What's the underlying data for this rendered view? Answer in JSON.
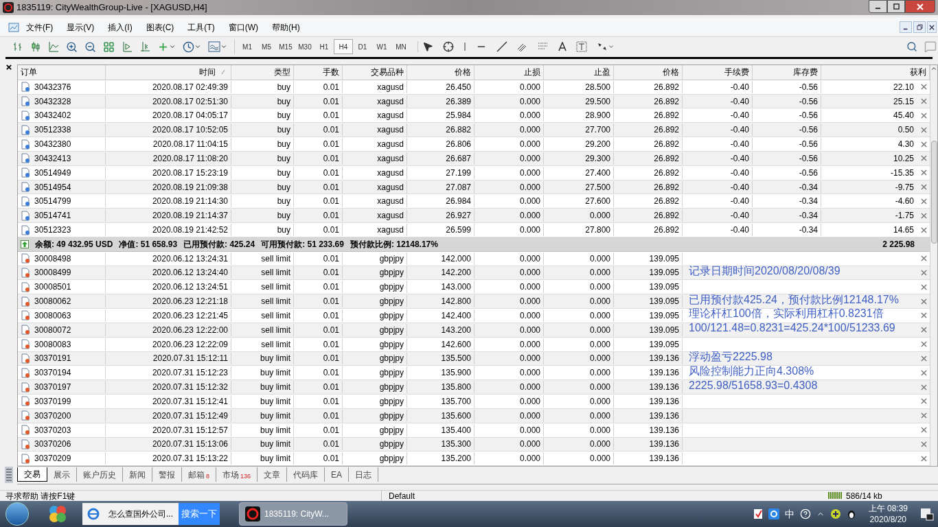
{
  "window": {
    "title": "1835119: CityWealthGroup-Live - [XAGUSD,H4]"
  },
  "menu": [
    "文件(F)",
    "显示(V)",
    "插入(I)",
    "图表(C)",
    "工具(T)",
    "窗口(W)",
    "帮助(H)"
  ],
  "periods": [
    {
      "label": "M1",
      "selected": false
    },
    {
      "label": "M5",
      "selected": false
    },
    {
      "label": "M15",
      "selected": false
    },
    {
      "label": "M30",
      "selected": false
    },
    {
      "label": "H1",
      "selected": false
    },
    {
      "label": "H4",
      "selected": true
    },
    {
      "label": "D1",
      "selected": false
    },
    {
      "label": "W1",
      "selected": false
    },
    {
      "label": "MN",
      "selected": false
    }
  ],
  "table": {
    "columns": [
      "订单",
      "时间",
      "类型",
      "手数",
      "交易品种",
      "价格",
      "止损",
      "止盈",
      "价格",
      "手续费",
      "库存费",
      "获利"
    ],
    "rows": [
      {
        "kind": "market",
        "order": "30432376",
        "time": "2020.08.17 02:49:39",
        "type": "buy",
        "lots": "0.01",
        "symbol": "xagusd",
        "price": "26.450",
        "sl": "0.000",
        "tp": "28.500",
        "current": "26.892",
        "commission": "-0.40",
        "swap": "-0.56",
        "profit": "22.10"
      },
      {
        "kind": "market",
        "order": "30432328",
        "time": "2020.08.17 02:51:30",
        "type": "buy",
        "lots": "0.01",
        "symbol": "xagusd",
        "price": "26.389",
        "sl": "0.000",
        "tp": "29.500",
        "current": "26.892",
        "commission": "-0.40",
        "swap": "-0.56",
        "profit": "25.15"
      },
      {
        "kind": "market",
        "order": "30432402",
        "time": "2020.08.17 04:05:17",
        "type": "buy",
        "lots": "0.01",
        "symbol": "xagusd",
        "price": "25.984",
        "sl": "0.000",
        "tp": "28.900",
        "current": "26.892",
        "commission": "-0.40",
        "swap": "-0.56",
        "profit": "45.40"
      },
      {
        "kind": "market",
        "order": "30512338",
        "time": "2020.08.17 10:52:05",
        "type": "buy",
        "lots": "0.01",
        "symbol": "xagusd",
        "price": "26.882",
        "sl": "0.000",
        "tp": "27.700",
        "current": "26.892",
        "commission": "-0.40",
        "swap": "-0.56",
        "profit": "0.50"
      },
      {
        "kind": "market",
        "order": "30432380",
        "time": "2020.08.17 11:04:15",
        "type": "buy",
        "lots": "0.01",
        "symbol": "xagusd",
        "price": "26.806",
        "sl": "0.000",
        "tp": "29.200",
        "current": "26.892",
        "commission": "-0.40",
        "swap": "-0.56",
        "profit": "4.30"
      },
      {
        "kind": "market",
        "order": "30432413",
        "time": "2020.08.17 11:08:20",
        "type": "buy",
        "lots": "0.01",
        "symbol": "xagusd",
        "price": "26.687",
        "sl": "0.000",
        "tp": "29.300",
        "current": "26.892",
        "commission": "-0.40",
        "swap": "-0.56",
        "profit": "10.25"
      },
      {
        "kind": "market",
        "order": "30514949",
        "time": "2020.08.17 15:23:19",
        "type": "buy",
        "lots": "0.01",
        "symbol": "xagusd",
        "price": "27.199",
        "sl": "0.000",
        "tp": "27.400",
        "current": "26.892",
        "commission": "-0.40",
        "swap": "-0.56",
        "profit": "-15.35"
      },
      {
        "kind": "market",
        "order": "30514954",
        "time": "2020.08.19 21:09:38",
        "type": "buy",
        "lots": "0.01",
        "symbol": "xagusd",
        "price": "27.087",
        "sl": "0.000",
        "tp": "27.500",
        "current": "26.892",
        "commission": "-0.40",
        "swap": "-0.34",
        "profit": "-9.75"
      },
      {
        "kind": "market",
        "order": "30514799",
        "time": "2020.08.19 21:14:30",
        "type": "buy",
        "lots": "0.01",
        "symbol": "xagusd",
        "price": "26.984",
        "sl": "0.000",
        "tp": "27.600",
        "current": "26.892",
        "commission": "-0.40",
        "swap": "-0.34",
        "profit": "-4.60"
      },
      {
        "kind": "market",
        "order": "30514741",
        "time": "2020.08.19 21:14:37",
        "type": "buy",
        "lots": "0.01",
        "symbol": "xagusd",
        "price": "26.927",
        "sl": "0.000",
        "tp": "0.000",
        "current": "26.892",
        "commission": "-0.40",
        "swap": "-0.34",
        "profit": "-1.75"
      },
      {
        "kind": "market",
        "order": "30512323",
        "time": "2020.08.19 21:42:52",
        "type": "buy",
        "lots": "0.01",
        "symbol": "xagusd",
        "price": "26.599",
        "sl": "0.000",
        "tp": "27.800",
        "current": "26.892",
        "commission": "-0.40",
        "swap": "-0.34",
        "profit": "14.65"
      },
      {
        "kind": "summary",
        "items": [
          "余额: 49 432.95 USD",
          "净值: 51 658.93",
          "已用预付款: 425.24",
          "可用预付款: 51 233.69",
          "预付款比例: 12148.17%"
        ],
        "profit": "2 225.98"
      },
      {
        "kind": "pending",
        "order": "30008498",
        "time": "2020.06.12 13:24:31",
        "type": "sell limit",
        "lots": "0.01",
        "symbol": "gbpjpy",
        "price": "142.000",
        "sl": "0.000",
        "tp": "0.000",
        "current": "139.095"
      },
      {
        "kind": "pending",
        "order": "30008499",
        "time": "2020.06.12 13:24:40",
        "type": "sell limit",
        "lots": "0.01",
        "symbol": "gbpjpy",
        "price": "142.200",
        "sl": "0.000",
        "tp": "0.000",
        "current": "139.095",
        "note": "记录日期时间2020/08/20/08/39"
      },
      {
        "kind": "pending",
        "order": "30008501",
        "time": "2020.06.12 13:24:51",
        "type": "sell limit",
        "lots": "0.01",
        "symbol": "gbpjpy",
        "price": "143.000",
        "sl": "0.000",
        "tp": "0.000",
        "current": "139.095"
      },
      {
        "kind": "pending",
        "order": "30080062",
        "time": "2020.06.23 12:21:18",
        "type": "sell limit",
        "lots": "0.01",
        "symbol": "gbpjpy",
        "price": "142.800",
        "sl": "0.000",
        "tp": "0.000",
        "current": "139.095",
        "note": "已用预付款425.24，预付款比例12148.17%"
      },
      {
        "kind": "pending",
        "order": "30080063",
        "time": "2020.06.23 12:21:45",
        "type": "sell limit",
        "lots": "0.01",
        "symbol": "gbpjpy",
        "price": "142.400",
        "sl": "0.000",
        "tp": "0.000",
        "current": "139.095",
        "note": "理论杆杠100倍，实际利用杠杆0.8231倍"
      },
      {
        "kind": "pending",
        "order": "30080072",
        "time": "2020.06.23 12:22:00",
        "type": "sell limit",
        "lots": "0.01",
        "symbol": "gbpjpy",
        "price": "143.200",
        "sl": "0.000",
        "tp": "0.000",
        "current": "139.095",
        "note": "100/121.48=0.8231=425.24*100/51233.69"
      },
      {
        "kind": "pending",
        "order": "30080083",
        "time": "2020.06.23 12:22:09",
        "type": "sell limit",
        "lots": "0.01",
        "symbol": "gbpjpy",
        "price": "142.600",
        "sl": "0.000",
        "tp": "0.000",
        "current": "139.095"
      },
      {
        "kind": "pending",
        "order": "30370191",
        "time": "2020.07.31 15:12:11",
        "type": "buy limit",
        "lots": "0.01",
        "symbol": "gbpjpy",
        "price": "135.500",
        "sl": "0.000",
        "tp": "0.000",
        "current": "139.136",
        "note": "浮动盈亏2225.98"
      },
      {
        "kind": "pending",
        "order": "30370194",
        "time": "2020.07.31 15:12:23",
        "type": "buy limit",
        "lots": "0.01",
        "symbol": "gbpjpy",
        "price": "135.900",
        "sl": "0.000",
        "tp": "0.000",
        "current": "139.136",
        "note": "风险控制能力正向4.308%"
      },
      {
        "kind": "pending",
        "order": "30370197",
        "time": "2020.07.31 15:12:32",
        "type": "buy limit",
        "lots": "0.01",
        "symbol": "gbpjpy",
        "price": "135.800",
        "sl": "0.000",
        "tp": "0.000",
        "current": "139.136",
        "note": "2225.98/51658.93=0.4308"
      },
      {
        "kind": "pending",
        "order": "30370199",
        "time": "2020.07.31 15:12:41",
        "type": "buy limit",
        "lots": "0.01",
        "symbol": "gbpjpy",
        "price": "135.700",
        "sl": "0.000",
        "tp": "0.000",
        "current": "139.136"
      },
      {
        "kind": "pending",
        "order": "30370200",
        "time": "2020.07.31 15:12:49",
        "type": "buy limit",
        "lots": "0.01",
        "symbol": "gbpjpy",
        "price": "135.600",
        "sl": "0.000",
        "tp": "0.000",
        "current": "139.136"
      },
      {
        "kind": "pending",
        "order": "30370203",
        "time": "2020.07.31 15:12:57",
        "type": "buy limit",
        "lots": "0.01",
        "symbol": "gbpjpy",
        "price": "135.400",
        "sl": "0.000",
        "tp": "0.000",
        "current": "139.136"
      },
      {
        "kind": "pending",
        "order": "30370206",
        "time": "2020.07.31 15:13:06",
        "type": "buy limit",
        "lots": "0.01",
        "symbol": "gbpjpy",
        "price": "135.300",
        "sl": "0.000",
        "tp": "0.000",
        "current": "139.136"
      },
      {
        "kind": "pending",
        "order": "30370209",
        "time": "2020.07.31 15:13:22",
        "type": "buy limit",
        "lots": "0.01",
        "symbol": "gbpjpy",
        "price": "135.200",
        "sl": "0.000",
        "tp": "0.000",
        "current": "139.136"
      }
    ]
  },
  "tabs": [
    {
      "label": "交易",
      "selected": true
    },
    {
      "label": "展示",
      "selected": false
    },
    {
      "label": "账户历史",
      "selected": false
    },
    {
      "label": "新闻",
      "selected": false
    },
    {
      "label": "警报",
      "selected": false
    },
    {
      "label": "邮箱",
      "selected": false,
      "badge": "8"
    },
    {
      "label": "市场",
      "selected": false,
      "badge": "136"
    },
    {
      "label": "文章",
      "selected": false
    },
    {
      "label": "代码库",
      "selected": false
    },
    {
      "label": "EA",
      "selected": false
    },
    {
      "label": "日志",
      "selected": false
    }
  ],
  "status_bar": {
    "help": "寻求帮助 请按F1键",
    "profile": "Default",
    "traffic": "586/14 kb"
  },
  "taskbar": {
    "browser_item": "怎么查国外公司...",
    "search_button": "搜索一下",
    "app_item": "1835119: CityW...",
    "ime": "中",
    "time": "上午 08:39",
    "date": "2020/8/20"
  }
}
